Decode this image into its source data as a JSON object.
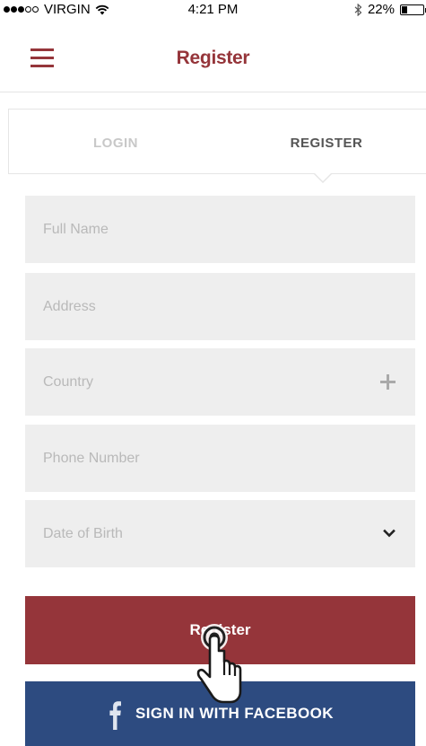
{
  "status_bar": {
    "carrier": "VIRGIN",
    "time": "4:21 PM",
    "battery": "22%",
    "battery_level": 0.22,
    "signal_bars": 3
  },
  "nav": {
    "title": "Register",
    "menu_icon": "hamburger-menu-icon"
  },
  "tabs": {
    "login": "LOGIN",
    "register": "REGISTER",
    "active": "register"
  },
  "form": {
    "full_name": {
      "placeholder": "Full Name",
      "value": ""
    },
    "address": {
      "placeholder": "Address",
      "value": ""
    },
    "country": {
      "placeholder": "Country",
      "value": "",
      "icon": "plus-icon"
    },
    "phone": {
      "placeholder": "Phone Number",
      "value": ""
    },
    "dob": {
      "placeholder": "Date of Birth",
      "value": "",
      "icon": "chevron-down-icon"
    }
  },
  "buttons": {
    "register": "Register",
    "facebook": "SIGN IN WITH FACEBOOK",
    "facebook_icon": "facebook-icon"
  },
  "colors": {
    "brand": "#95353a",
    "facebook": "#2d4b80",
    "field_bg": "#eeeeee"
  }
}
